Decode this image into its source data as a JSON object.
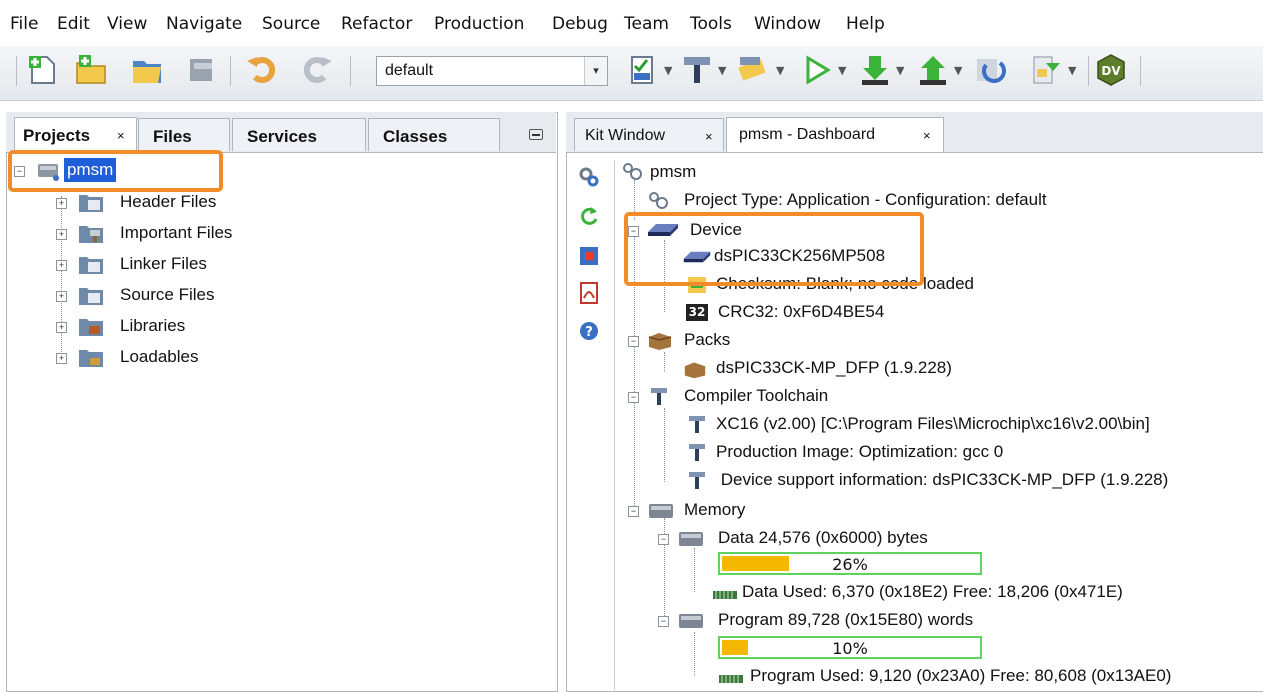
{
  "menu": [
    "File",
    "Edit",
    "View",
    "Navigate",
    "Source",
    "Refactor",
    "Production",
    "Debug",
    "Team",
    "Tools",
    "Window",
    "Help"
  ],
  "toolbar": {
    "config_value": "default",
    "icons": [
      "new-file-icon",
      "new-project-icon",
      "open-project-icon",
      "close-project-icon",
      "undo-icon",
      "redo-icon",
      "project-properties-icon",
      "clean-build-icon",
      "build-icon",
      "run-icon",
      "make-program-icon",
      "read-device-icon",
      "refresh-icon",
      "stepping-icon",
      "dv-icon"
    ]
  },
  "left_tabs": [
    "Projects",
    "Files",
    "Services",
    "Classes"
  ],
  "left_tab_close": "×",
  "project_tree": {
    "root": "pmsm",
    "items": [
      "Header Files",
      "Important Files",
      "Linker Files",
      "Source Files",
      "Libraries",
      "Loadables"
    ]
  },
  "right_tabs": [
    "Kit Window",
    "pmsm - Dashboard"
  ],
  "right_tab_close": "×",
  "dashboard": {
    "root": "pmsm",
    "project_type": "Project Type: Application - Configuration: default",
    "device_label": "Device",
    "device_name": "dsPIC33CK256MP508",
    "checksum": "Checksum: Blank; no code loaded",
    "crc_badge": "32",
    "crc": "CRC32: 0xF6D4BE54",
    "packs_label": "Packs",
    "pack": "dsPIC33CK-MP_DFP (1.9.228)",
    "compiler_label": "Compiler Toolchain",
    "compiler_items": [
      "XC16 (v2.00) [C:\\Program Files\\Microchip\\xc16\\v2.00\\bin]",
      "Production Image: Optimization: gcc 0",
      " Device support information: dsPIC33CK-MP_DFP (1.9.228)"
    ],
    "memory_label": "Memory",
    "data_mem_label": "Data 24,576 (0x6000) bytes",
    "data_percent_text": "26%",
    "data_percent": 26,
    "data_used": "Data Used: 6,370 (0x18E2) Free: 18,206 (0x471E)",
    "program_mem_label": "Program 89,728 (0x15E80) words",
    "program_percent_text": "10%",
    "program_percent": 10,
    "program_used": "Program Used: 9,120 (0x23A0) Free: 80,608 (0x13AE0)"
  },
  "colors": {
    "highlight": "#f28c28",
    "bar_fill": "#f5b800",
    "bar_border": "#5fd35f",
    "selection": "#1e5fd8"
  }
}
